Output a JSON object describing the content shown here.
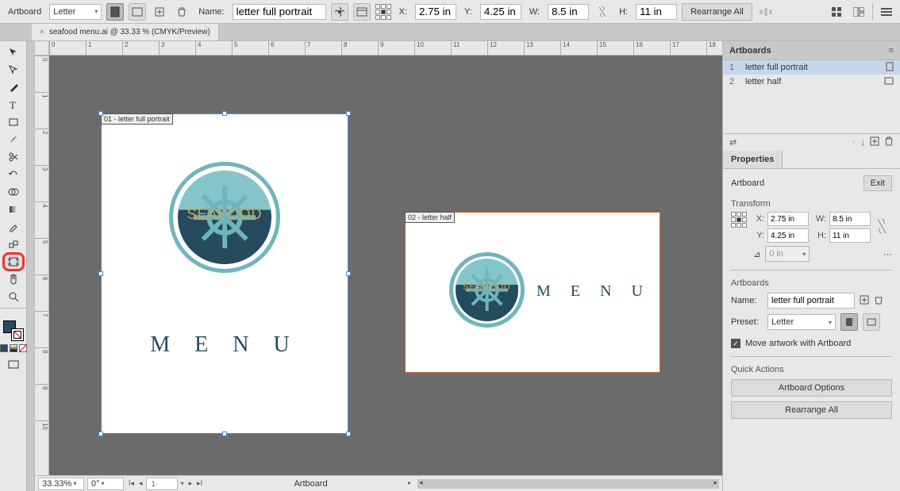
{
  "topbar": {
    "mode": "Artboard",
    "preset": "Letter",
    "name_label": "Name:",
    "name_value": "letter full portrait",
    "x_label": "X:",
    "x_value": "2.75 in",
    "y_label": "Y:",
    "y_value": "4.25 in",
    "w_label": "W:",
    "w_value": "8.5 in",
    "h_label": "H:",
    "h_value": "11 in",
    "rearrange": "Rearrange All"
  },
  "doctab": {
    "title": "seafood menu.ai @ 33.33 % (CMYK/Preview)"
  },
  "ruler_h": [
    "0",
    "1",
    "2",
    "3",
    "4",
    "5",
    "6",
    "7",
    "8",
    "9",
    "10",
    "11",
    "12",
    "13",
    "14",
    "15",
    "16",
    "17",
    "18"
  ],
  "ruler_v": [
    "0",
    "1",
    "2",
    "3",
    "4",
    "5",
    "6",
    "7",
    "8",
    "9",
    "10"
  ],
  "artboard1": {
    "label": "01 - letter full portrait",
    "word": "M E N U",
    "logo_text": "SEAFOOD"
  },
  "artboard2": {
    "label": "02 - letter half",
    "word": "M E N U",
    "logo_text": "SEAFOOD"
  },
  "status": {
    "zoom": "33.33%",
    "angle": "0°",
    "page": "1",
    "mode": "Artboard"
  },
  "panelArtboards": {
    "title": "Artboards",
    "rows": [
      {
        "num": "1",
        "name": "letter full portrait"
      },
      {
        "num": "2",
        "name": "letter half"
      }
    ]
  },
  "panelProps": {
    "tab": "Properties",
    "header": "Artboard",
    "exit": "Exit",
    "transform": "Transform",
    "x": "2.75 in",
    "y": "4.25 in",
    "w": "8.5 in",
    "h": "11 in",
    "angle": "0 in",
    "artboards_section": "Artboards",
    "name_label": "Name:",
    "name_value": "letter full portrait",
    "preset_label": "Preset:",
    "preset_value": "Letter",
    "move_check": "Move artwork with Artboard",
    "qa_title": "Quick Actions",
    "qa1": "Artboard Options",
    "qa2": "Rearrange All"
  }
}
